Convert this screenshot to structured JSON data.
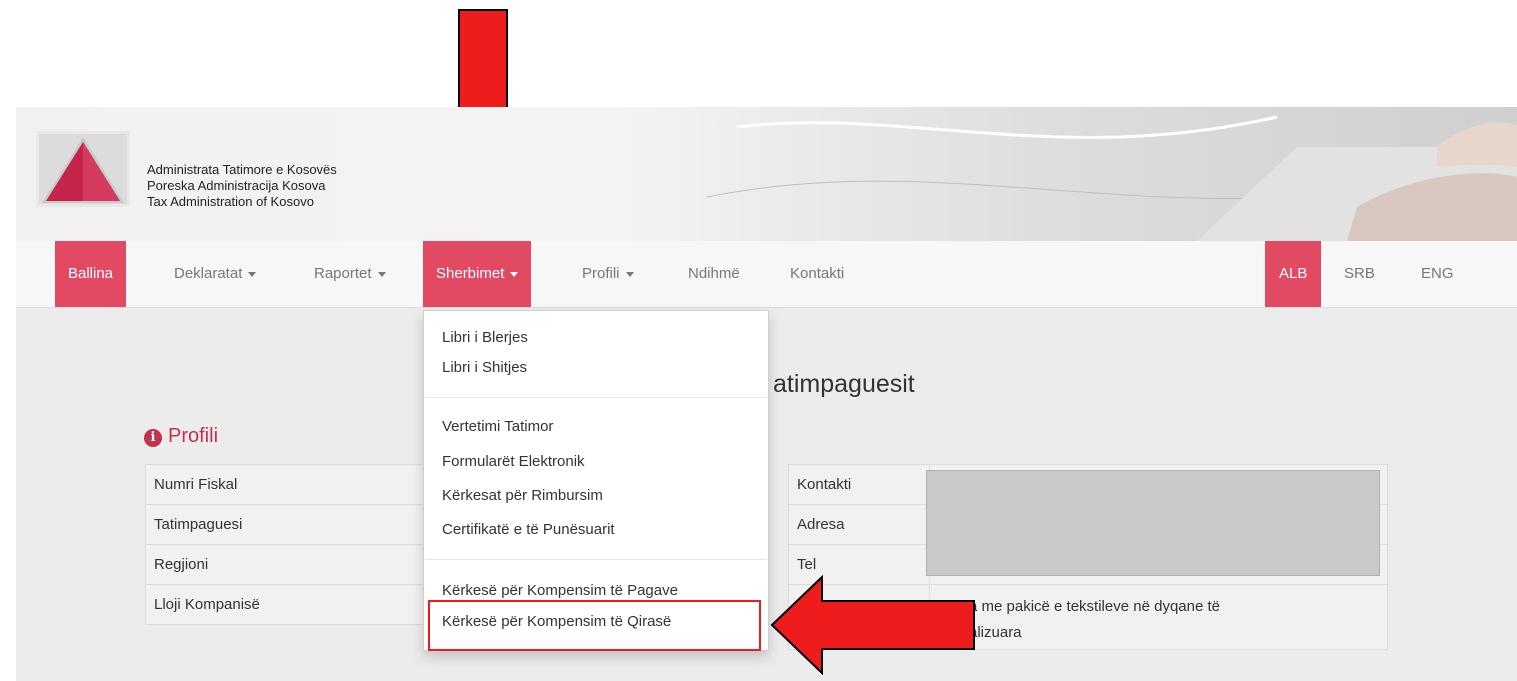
{
  "org": {
    "name_alb": "Administrata Tatimore e Kosovës",
    "name_srb": "Poreska Administracija Kosova",
    "name_eng": "Tax Administration of Kosovo"
  },
  "nav": {
    "ballina": "Ballina",
    "deklaratat": "Deklaratat",
    "raportet": "Raportet",
    "sherbimet": "Sherbimet",
    "profili": "Profili",
    "ndihme": "Ndihmë",
    "kontakti": "Kontakti",
    "lang_alb": "ALB",
    "lang_srb": "SRB",
    "lang_eng": "ENG"
  },
  "dropdown": {
    "items": [
      "Libri i Blerjes",
      "Libri i Shitjes",
      "Vertetimi Tatimor",
      "Formularët Elektronik",
      "Kërkesat për Rimbursim",
      "Certifikatë e të Punësuarit",
      "Kërkesë për Kompensim të Pagave",
      "Kërkesë për Kompensim të Qirasë"
    ]
  },
  "page": {
    "title_partial": "atimpaguesit",
    "section_title": "Profili"
  },
  "profile_left": {
    "labels": [
      "Numri Fiskal",
      "Tatimpaguesi",
      "Regjioni",
      "Lloji Kompanisë"
    ]
  },
  "profile_right": {
    "labels": [
      "Kontakti",
      "Adresa",
      "Tel"
    ],
    "activity_line1": "a me pakicë e tekstileve në dyqane të",
    "activity_line2": "alizuara"
  },
  "colors": {
    "brand": "#e14a62",
    "annotation_arrow": "#ee1c1c"
  }
}
